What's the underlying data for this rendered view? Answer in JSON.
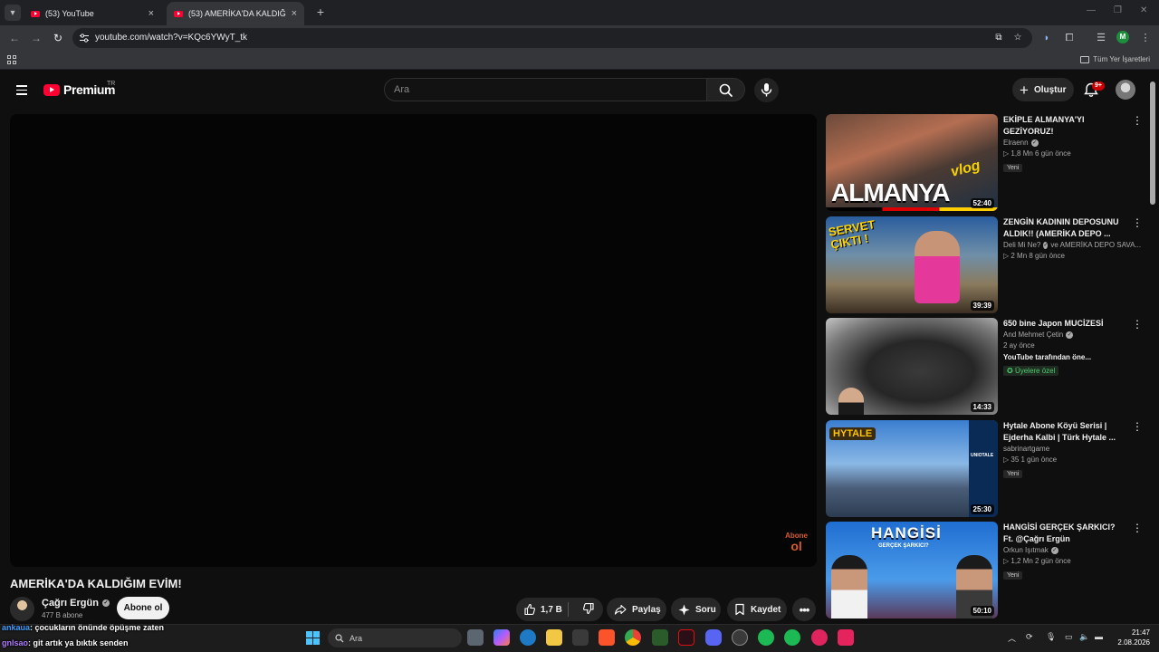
{
  "browser": {
    "tabs": [
      {
        "title": "(53) YouTube",
        "active": false
      },
      {
        "title": "(53) AMERİKA'DA KALDIĞIM EV",
        "active": true
      }
    ],
    "url": "youtube.com/watch?v=KQc6YWyT_tk",
    "bookmarks_all": "Tüm Yer İşaretleri",
    "profile_initial": "M"
  },
  "youtube": {
    "logo_text": "Premium",
    "country_code": "TR",
    "search_placeholder": "Ara",
    "create_label": "Oluştur",
    "notification_count": "9+"
  },
  "video": {
    "title": "AMERİKA'DA KALDIĞIM EVİM!",
    "channel": "Çağrı Ergün",
    "subscribers": "477 B abone",
    "subscribe_label": "Abone ol",
    "like_count": "1,7 B",
    "share_label": "Paylaş",
    "ask_label": "Soru",
    "save_label": "Kaydet",
    "watermark_top": "Abone",
    "watermark_bottom": "ol"
  },
  "recommendations": [
    {
      "title": "EKİPLE ALMANYA'YI GEZİYORUZ!",
      "channel": "Elraenn",
      "verified": true,
      "stats": "▷ 1,8 Mn  6 gün önce",
      "badge": "Yeni",
      "duration": "52:40",
      "thumb_word": "ALMANYA",
      "thumb_extra": "vlog"
    },
    {
      "title": "ZENGİN KADININ DEPOSUNU ALDIK!! (AMERİKA DEPO ...",
      "channel": "Deli Mi Ne?",
      "verified": true,
      "channel_extra": "ve AMERİKA DEPO SAVA...",
      "stats": "▷ 2 Mn  8 gün önce",
      "duration": "39:39",
      "thumb_word": "SERVET ÇIKTI !"
    },
    {
      "title": "650 bine Japon MUCİZESİ",
      "channel": "And Mehmet Çetin",
      "verified": true,
      "stats": "2 ay önce",
      "note": "YouTube tarafından öne...",
      "member": "Üyelere özel",
      "duration": "14:33"
    },
    {
      "title": "Hytale Abone Köyü Serisi | Ejderha Kalbi | Türk Hytale ...",
      "channel": "sabrinartgame",
      "verified": false,
      "stats": "▷ 35  1 gün önce",
      "badge": "Yeni",
      "duration": "25:30",
      "thumb_word": "HYTALE",
      "thumb_extra": "UNIOTALE"
    },
    {
      "title": "HANGİSİ GERÇEK ŞARKICI? Ft. @Çağrı Ergün",
      "channel": "Orkun Işıtmak",
      "verified": true,
      "stats": "▷ 1,2 Mn  2 gün önce",
      "badge": "Yeni",
      "duration": "50:10",
      "thumb_word": "HANGİSİ",
      "thumb_extra": "GERÇEK ŞARKICI?"
    }
  ],
  "chat": [
    {
      "user": "ankaua",
      "message": ": çocukların önünde öpüşme zaten"
    },
    {
      "user": "gnlsao",
      "message": ": git artık ya bıktık senden"
    }
  ],
  "taskbar": {
    "search_placeholder": "Ara",
    "time": "21:47",
    "date": "2.08.2026"
  },
  "colors": {
    "youtube_red": "#ff0033",
    "background": "#0f0f0f",
    "chip": "#272727",
    "member_green": "#4bce6c"
  }
}
